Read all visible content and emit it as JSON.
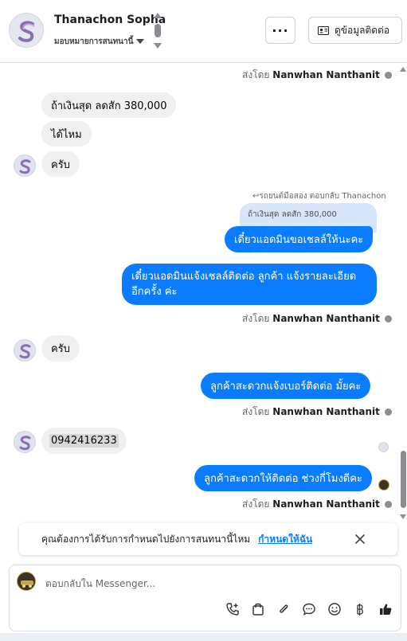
{
  "header": {
    "contact_name": "Thanachon Sopha",
    "assign_label": "มอบหมายการสนทนานี้",
    "more_label": "···",
    "contact_info_label": "ดูข้อมูลติดต่อ"
  },
  "messages": {
    "sent_by_prefix": "ส่งโดย",
    "agent_name": "Nanwhan Nanthanit",
    "m1": "ถ้าเงินสุด ลดสัก 380,000",
    "m2": "ได้ไหม",
    "m3": "ครับ",
    "reply_meta": "รถยนต์มือสอง ตอบกลับ Thanachon",
    "reply_quote": "ถ้าเงินสุด ลดสัก 380,000",
    "m4": "เดี๋ยวแอดมินขอเชลล์ให้นะคะ",
    "m5_line1": "เดี๋ยวแอดมินแจ้งเชลล์ติดต่อ ลูกค้า แจ้งรายละเอียด",
    "m5_line2": "อีกครั้ง ค่ะ",
    "m6": "ครับ",
    "m7": "ลูกค้าสะดวกแจ้งเบอร์ติดต่อ มั้ยคะ",
    "m8": "0942416233",
    "m9": "ลูกค้าสะดวกให้ติดต่อ ช่วงกี่โมงดีคะ"
  },
  "banner": {
    "text": "คุณต้องการได้รับการกำหนดไปยังการสนทนานี้ไหม",
    "link": "กำหนดให้ฉัน"
  },
  "composer": {
    "placeholder": "ตอบกลับใน Messenger..."
  },
  "colors": {
    "accent": "#0a7cff",
    "incoming_bubble": "#f0f0f0"
  },
  "icons": [
    "ellipsis-icon",
    "contact-card-icon",
    "chevron-down-icon",
    "help-icon",
    "close-icon",
    "call-add-icon",
    "shopping-bag-icon",
    "paperclip-icon",
    "chat-bubble-icon",
    "emoji-icon",
    "baht-icon",
    "thumbs-up-icon"
  ]
}
